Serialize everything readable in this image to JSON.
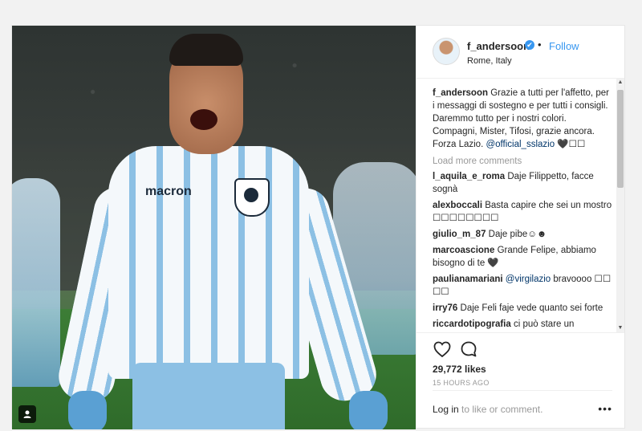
{
  "post": {
    "username": "f_andersoon",
    "verified_mark": "✔",
    "separator": "•",
    "follow_label": "Follow",
    "location": "Rome, Italy",
    "shirt_brand": "macron",
    "caption_user": "f_andersoon",
    "caption_text": "Grazie a tutti per l'affetto, per i messaggi di sostegno e per tutti i consigli. Daremmo tutto per i nostri colori. Compagni, Mister, Tifosi, grazie ancora. Forza Lazio.",
    "caption_mention": "@official_sslazio",
    "caption_emoji": "🖤☐☐",
    "load_more": "Load more comments",
    "comments": [
      {
        "user": "l_aquila_e_roma",
        "text": "Daje Filippetto, facce sognà"
      },
      {
        "user": "alexboccali",
        "text": "Basta capire che sei un mostro ☐☐☐☐☐☐☐☐"
      },
      {
        "user": "giulio_m_87",
        "text": "Daje pibe☺☻"
      },
      {
        "user": "marcoascione",
        "text": "Grande Felipe, abbiamo bisogno di te 🖤"
      },
      {
        "user": "paulianamariani",
        "mention": "@virgilazio",
        "text": "bravoooo ☐☐ ☐☐"
      },
      {
        "user": "irry76",
        "text": "Daje Feli faje vede quanto sei forte"
      },
      {
        "user": "riccardotipografia",
        "text": "ci può stare un"
      }
    ],
    "likes": "29,772 likes",
    "time": "15 HOURS AGO",
    "login_link": "Log in",
    "login_suffix": "to like or comment.",
    "more_options": "•••",
    "colors": {
      "accent": "#3897f0",
      "muted": "#999999",
      "text": "#262626",
      "mention": "#003569"
    },
    "icons": [
      "heart-icon",
      "comment-icon",
      "user-tag-icon",
      "verified-badge-icon"
    ]
  }
}
